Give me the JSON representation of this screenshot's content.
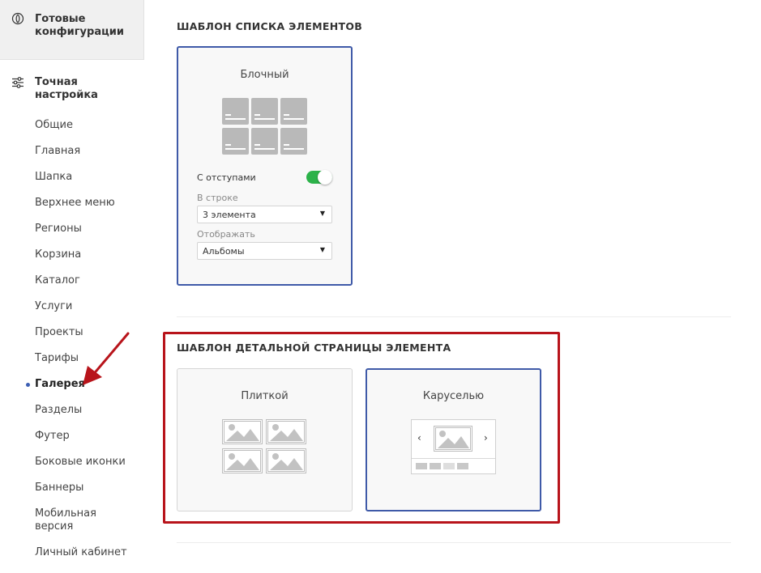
{
  "sidebar": {
    "ready_configs": {
      "line1": "Готовые",
      "line2": "конфигурации"
    },
    "fine_tuning": {
      "line1": "Точная",
      "line2": "настройка"
    },
    "items": [
      {
        "label": "Общие"
      },
      {
        "label": "Главная"
      },
      {
        "label": "Шапка"
      },
      {
        "label": "Верхнее меню"
      },
      {
        "label": "Регионы"
      },
      {
        "label": "Корзина"
      },
      {
        "label": "Каталог"
      },
      {
        "label": "Услуги"
      },
      {
        "label": "Проекты"
      },
      {
        "label": "Тарифы"
      },
      {
        "label": "Галерея",
        "active": true
      },
      {
        "label": "Разделы"
      },
      {
        "label": "Футер"
      },
      {
        "label": "Боковые иконки"
      },
      {
        "label": "Баннеры"
      },
      {
        "label": "Мобильная",
        "label2": "версия"
      },
      {
        "label": "Личный кабинет"
      }
    ]
  },
  "list_template": {
    "title": "ШАБЛОН СПИСКА ЭЛЕМЕНТОВ",
    "card": {
      "label": "Блочный",
      "selected": true,
      "padding_label": "С отступами",
      "padding_on": true,
      "per_row_label": "В строке",
      "per_row_value": "3 элемента",
      "display_label": "Отображать",
      "display_value": "Альбомы"
    }
  },
  "detail_template": {
    "title": "ШАБЛОН ДЕТАЛЬНОЙ СТРАНИЦЫ ЭЛЕМЕНТА",
    "cards": [
      {
        "label": "Плиткой",
        "selected": false
      },
      {
        "label": "Каруселью",
        "selected": true
      }
    ],
    "carousel_prev": "‹",
    "carousel_next": "›"
  },
  "colors": {
    "accent": "#3f5aa8",
    "toggle_on": "#2cb24a",
    "highlight": "#b8141b",
    "arrow": "#b8141b",
    "sidebar_bg": "#f0f0f0"
  },
  "icons": [
    "ready-configs-icon",
    "settings-sliders-icon",
    "toggle-switch",
    "chevron-down-icon",
    "image-placeholder-icon",
    "chevron-left-icon",
    "chevron-right-icon",
    "red-arrow-annotation"
  ]
}
